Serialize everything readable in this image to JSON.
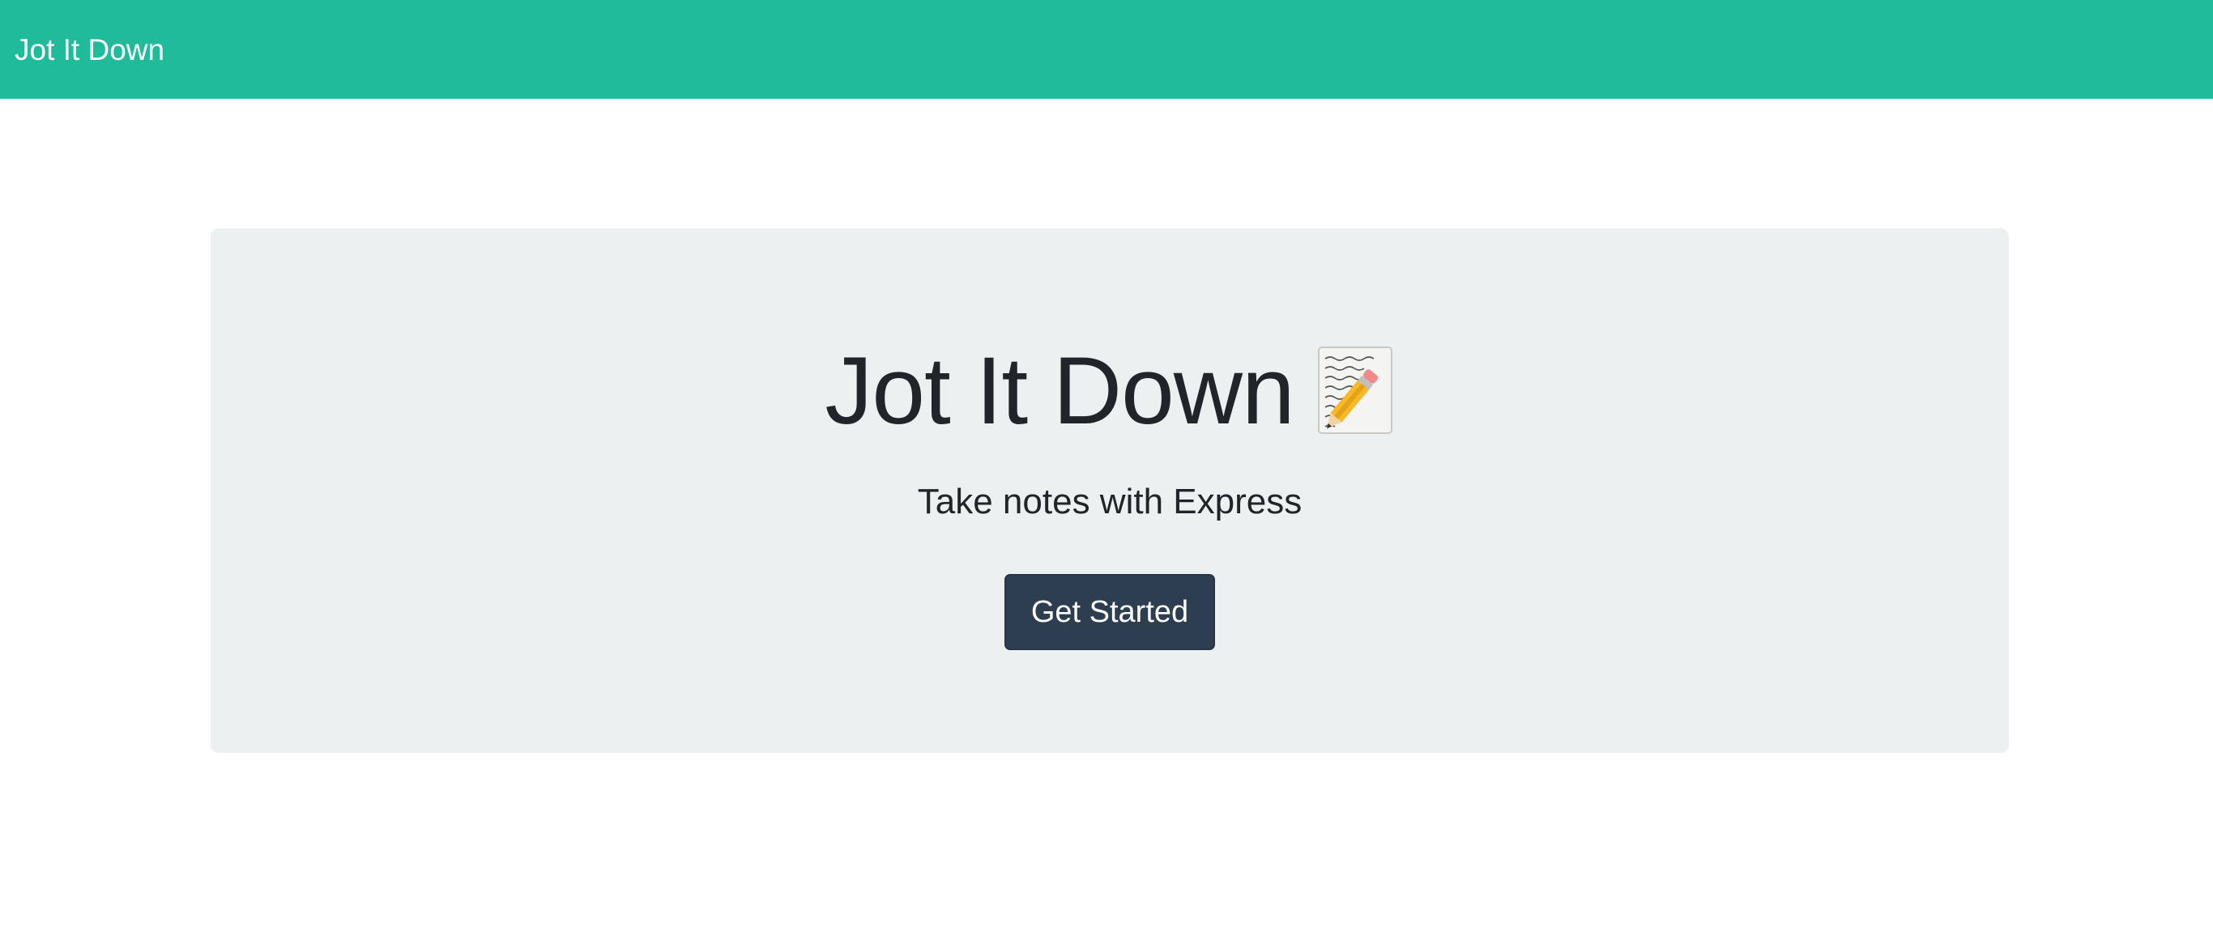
{
  "navbar": {
    "brand": "Jot It Down"
  },
  "hero": {
    "title": "Jot It Down",
    "title_icon": "memo-icon",
    "subtitle": "Take notes with Express",
    "cta_label": "Get Started"
  },
  "colors": {
    "brand": "#1fbb9b",
    "panel": "#ecf0f1",
    "button": "#2c3e50",
    "text": "#212529"
  }
}
